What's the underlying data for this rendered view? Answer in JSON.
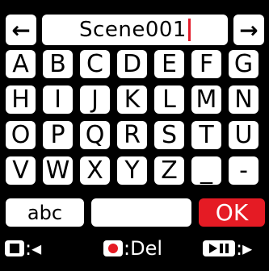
{
  "header": {
    "left_arrow": "←",
    "right_arrow": "→",
    "field_value": "Scene001"
  },
  "keys": {
    "row1": [
      "A",
      "B",
      "C",
      "D",
      "E",
      "F",
      "G"
    ],
    "row2": [
      "H",
      "I",
      "J",
      "K",
      "L",
      "M",
      "N"
    ],
    "row3": [
      "O",
      "P",
      "Q",
      "R",
      "S",
      "T",
      "U"
    ],
    "row4": [
      "V",
      "W",
      "X",
      "Y",
      "Z",
      "_",
      "-"
    ]
  },
  "bottom": {
    "abc_label": "abc",
    "ok_label": "OK"
  },
  "footer": {
    "stop_action": ":◂",
    "rec_action": ":Del",
    "play_action": ":▸"
  },
  "colors": {
    "accent": "#E51B24",
    "cursor": "#E31B2A",
    "key_bg": "#FFFFFF",
    "screen_bg": "#000000"
  }
}
